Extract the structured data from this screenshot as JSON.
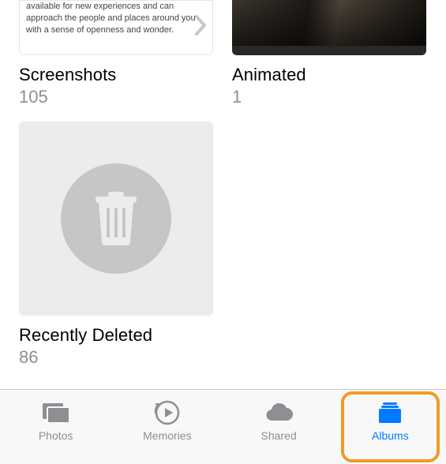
{
  "albums": {
    "screenshots": {
      "title": "Screenshots",
      "count": "105",
      "preview_text": "available for new experiences and can approach the people and places around you with a sense of openness and wonder."
    },
    "animated": {
      "title": "Animated",
      "count": "1"
    },
    "recently_deleted": {
      "title": "Recently Deleted",
      "count": "86"
    }
  },
  "tabs": {
    "photos": {
      "label": "Photos"
    },
    "memories": {
      "label": "Memories"
    },
    "shared": {
      "label": "Shared"
    },
    "albums": {
      "label": "Albums"
    }
  },
  "colors": {
    "accent": "#007aff",
    "highlight": "#f09a2a",
    "muted": "#8e8e93"
  }
}
